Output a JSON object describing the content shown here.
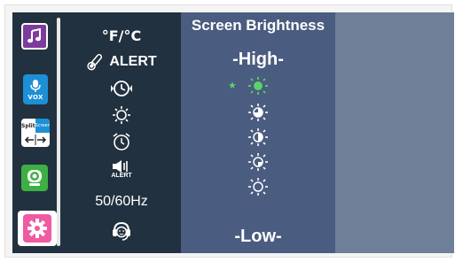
{
  "menu": {
    "temp_unit": "°F/°C",
    "temp_alert": "ALERT",
    "sound_alert": "ALERT",
    "frequency": "50/60Hz"
  },
  "sidebar": {
    "vox_label": "VOX",
    "split_left": "Split",
    "split_right": "Screen"
  },
  "brightness": {
    "title": "Screen Brightness",
    "high_label": "-High-",
    "low_label": "-Low-",
    "selected_level": 1,
    "level_count": 5
  },
  "colors": {
    "menu_bg": "#22313f",
    "panel_bg": "#4a5c80",
    "right_bg": "#6e7f97",
    "selected": "#58d468",
    "pointer": "#f2c500"
  }
}
